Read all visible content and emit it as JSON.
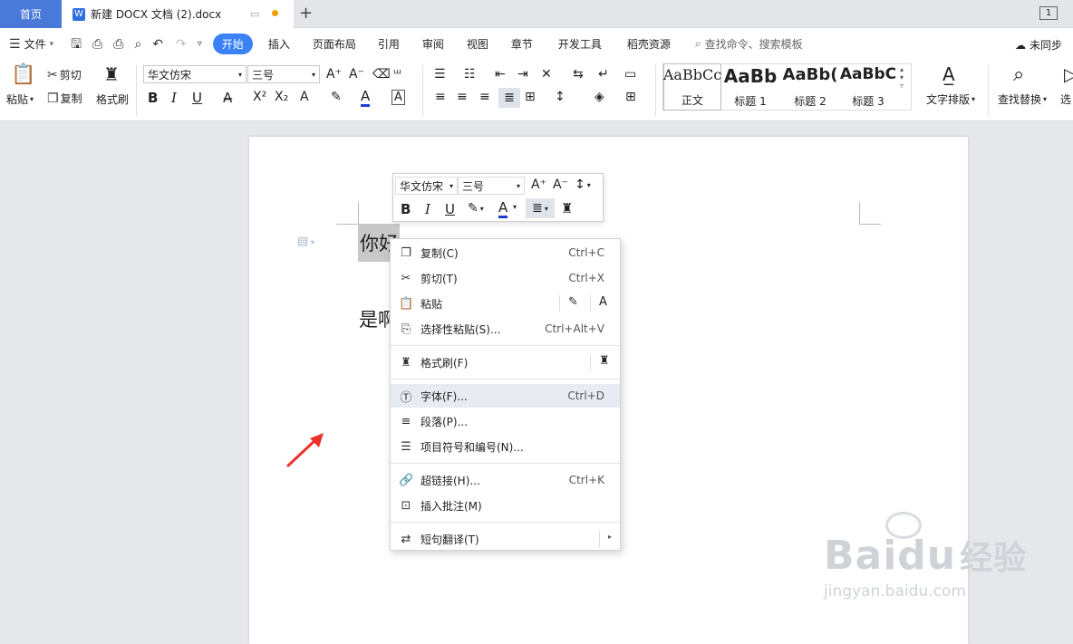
{
  "tabs": {
    "home": "首页",
    "doc": "新建 DOCX 文档 (2).docx",
    "add": "+",
    "page_indicator": "1"
  },
  "menu": {
    "file": "文件",
    "items": [
      "开始",
      "插入",
      "页面布局",
      "引用",
      "审阅",
      "视图",
      "章节",
      "开发工具",
      "稻壳资源"
    ],
    "search": "查找命令、搜索模板",
    "sync": "未同步"
  },
  "ribbon": {
    "paste": "粘贴",
    "cut": "剪切",
    "copy": "复制",
    "format_brush": "格式刷",
    "font_name": "华文仿宋",
    "font_size": "三号",
    "styles": [
      {
        "preview": "AaBbCc",
        "label": "正文"
      },
      {
        "preview": "AaBb",
        "label": "标题 1"
      },
      {
        "preview": "AaBb(",
        "label": "标题 2"
      },
      {
        "preview": "AaBbC",
        "label": "标题 3"
      }
    ],
    "text_layout": "文字排版",
    "find_replace": "查找替换",
    "select": "选"
  },
  "doc": {
    "line1": "你好",
    "line2": "是啊"
  },
  "mini_toolbar": {
    "font_name": "华文仿宋",
    "font_size": "三号"
  },
  "context_menu": [
    {
      "label": "复制(C)",
      "shortcut": "Ctrl+C",
      "icon": "copy-icon"
    },
    {
      "label": "剪切(T)",
      "shortcut": "Ctrl+X",
      "icon": "scissors-icon"
    },
    {
      "label": "粘贴",
      "shortcut": "",
      "icon": "paste-icon"
    },
    {
      "label": "选择性粘贴(S)...",
      "shortcut": "Ctrl+Alt+V",
      "icon": "paste-special-icon"
    },
    {
      "label": "格式刷(F)",
      "shortcut": "",
      "icon": "format-brush-icon"
    },
    {
      "label": "字体(F)...",
      "shortcut": "Ctrl+D",
      "icon": "font-icon"
    },
    {
      "label": "段落(P)...",
      "shortcut": "",
      "icon": "paragraph-icon"
    },
    {
      "label": "项目符号和编号(N)...",
      "shortcut": "",
      "icon": "bullet-list-icon"
    },
    {
      "label": "超链接(H)...",
      "shortcut": "Ctrl+K",
      "icon": "link-icon"
    },
    {
      "label": "插入批注(M)",
      "shortcut": "",
      "icon": "comment-icon"
    },
    {
      "label": "短句翻译(T)",
      "shortcut": "",
      "icon": "translate-icon"
    }
  ],
  "watermark": {
    "brand": "Baidu",
    "cn": "经验",
    "url": "jingyan.baidu.com"
  },
  "colors": {
    "accent": "#3b82f6",
    "home_tab": "#4a7ad9",
    "arrow": "#e8322b",
    "highlight": "#c8c8c8",
    "hover_row": "#e8ecf2"
  }
}
